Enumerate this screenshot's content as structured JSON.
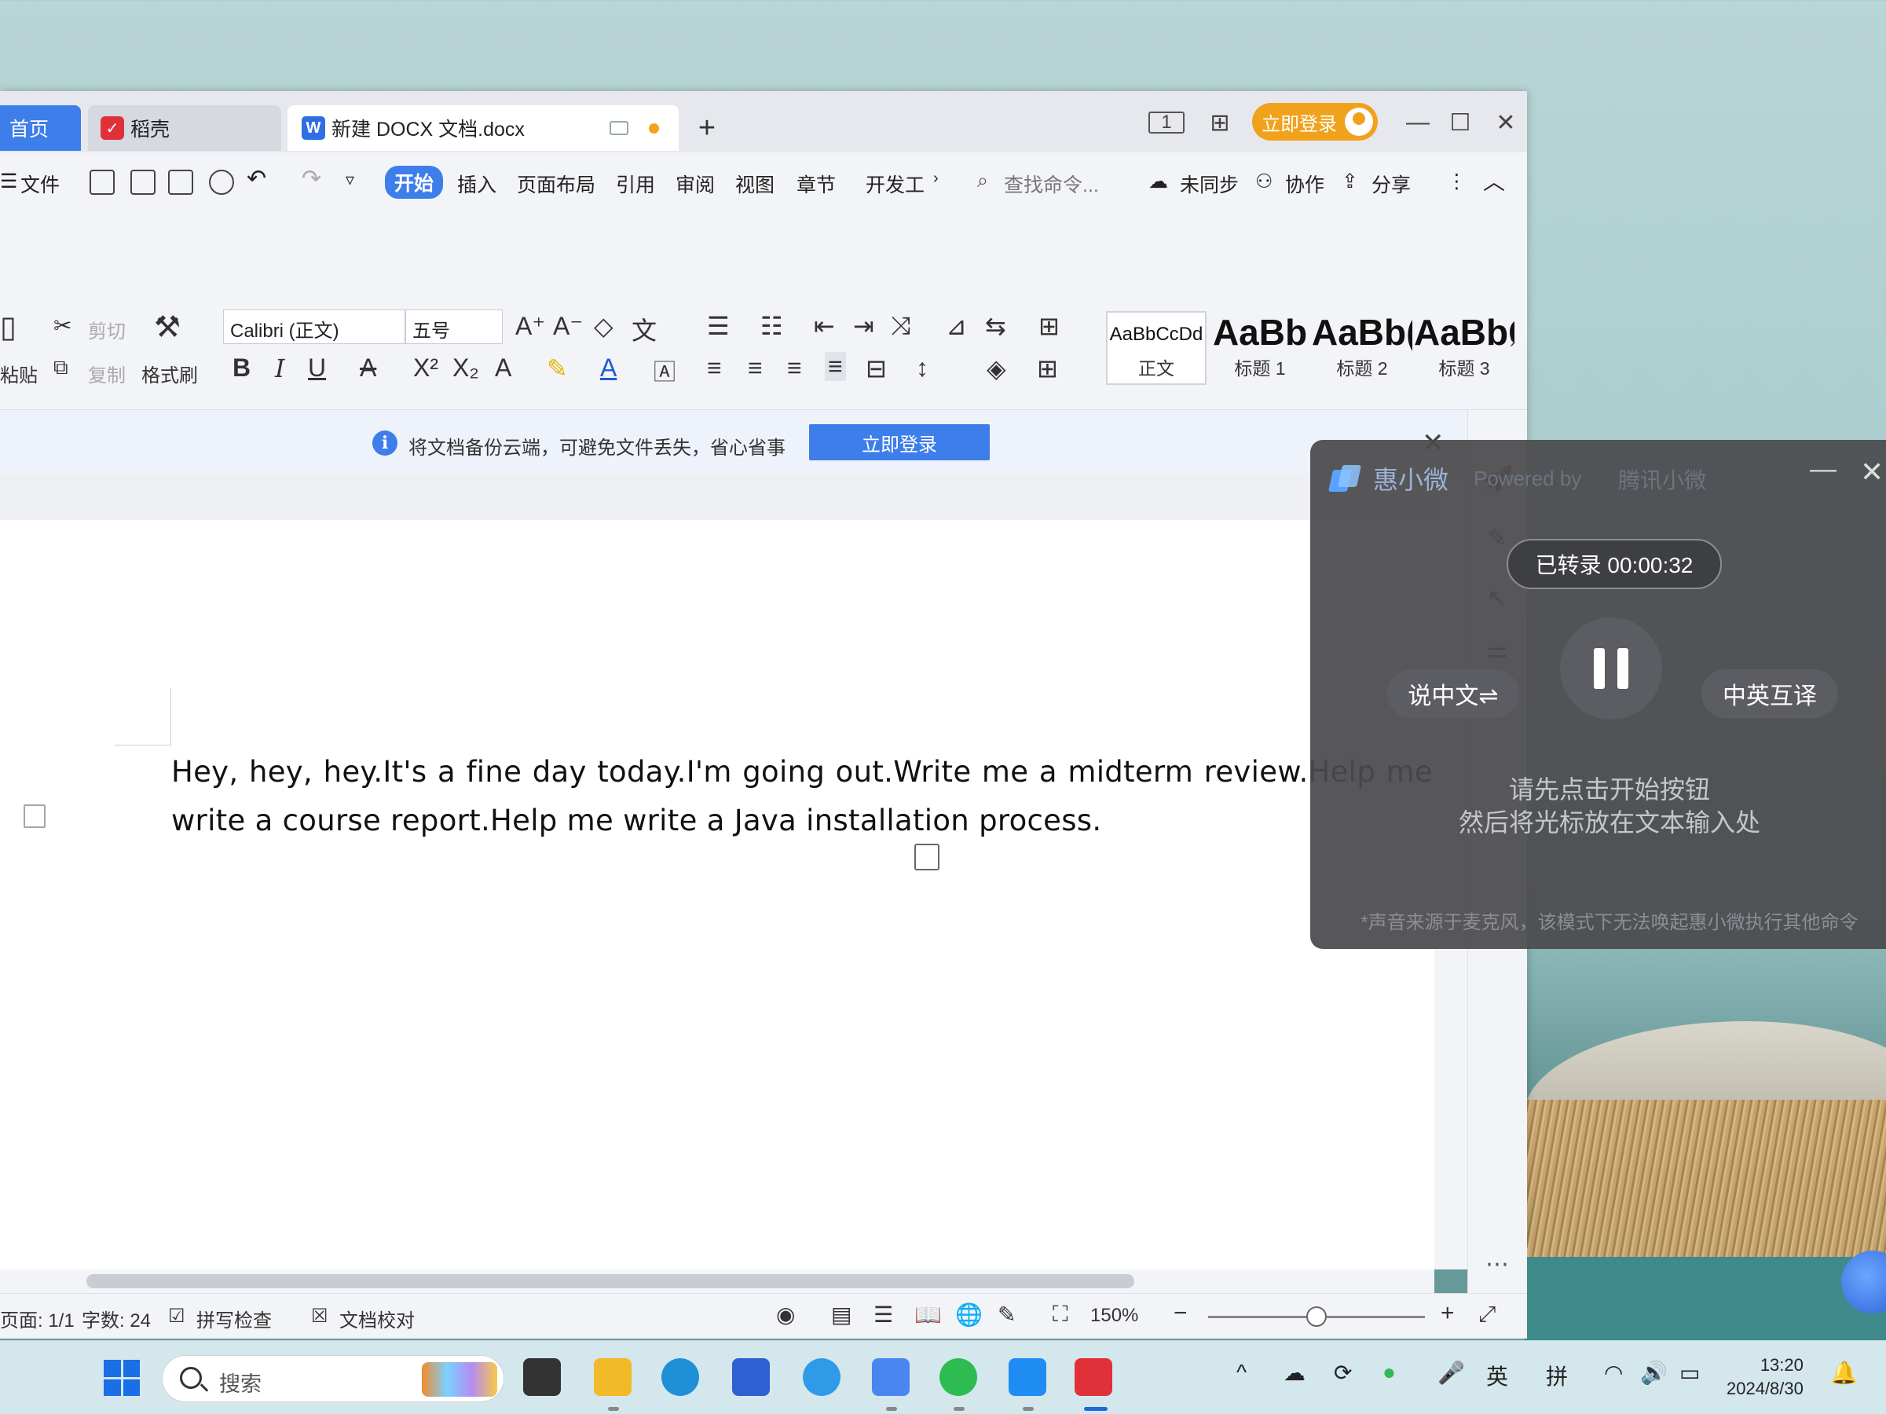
{
  "window": {
    "tabs": [
      {
        "label": "首页"
      },
      {
        "label": "稻壳"
      },
      {
        "label": "新建 DOCX 文档.docx"
      }
    ],
    "login_button": "立即登录"
  },
  "menu": {
    "file": "文件",
    "items": [
      "开始",
      "插入",
      "页面布局",
      "引用",
      "审阅",
      "视图",
      "章节",
      "开发工"
    ],
    "search_placeholder": "查找命令...",
    "sync": "未同步",
    "collab": "协作",
    "share": "分享"
  },
  "ribbon": {
    "paste": "粘贴",
    "cut": "剪切",
    "copy": "复制",
    "format_painter": "格式刷",
    "font_name": "Calibri (正文)",
    "font_size": "五号",
    "styles": [
      {
        "sample": "AaBbCcDd",
        "name": "正文"
      },
      {
        "sample": "AaBb",
        "name": "标题 1"
      },
      {
        "sample": "AaBb(",
        "name": "标题 2"
      },
      {
        "sample": "AaBbC",
        "name": "标题 3"
      }
    ]
  },
  "notice": {
    "message": "将文档备份云端，可避免文件丢失，省心省事",
    "button": "立即登录"
  },
  "document": {
    "text": "Hey, hey, hey.It's a fine day today.I'm going out.Write me a midterm review.Help me write a course report.Help me write a Java installation process."
  },
  "statusbar": {
    "page": "页面: 1/1",
    "word_count": "字数: 24",
    "spell_check": "拼写检查",
    "proofread": "文档校对",
    "zoom": "150%",
    "zoom_level": 0.5
  },
  "assistant": {
    "name": "惠小微",
    "powered_by": "Powered by",
    "brand": "腾讯小微",
    "transcribed": "已转录 00:00:32",
    "mode_cn": "说中文⇌",
    "mode_en": "中英互译",
    "hint_line1": "请先点击开始按钮",
    "hint_line2": "然后将光标放在文本输入处",
    "footnote": "*声音来源于麦克风，该模式下无法唤起惠小微执行其他命令"
  },
  "taskbar": {
    "search_placeholder": "搜索",
    "ime_lang": "英",
    "ime_mode": "拼",
    "time": "13:20",
    "date": "2024/8/30"
  },
  "colors": {
    "accent": "#3d7eea",
    "login_orange": "#f0a21d"
  }
}
